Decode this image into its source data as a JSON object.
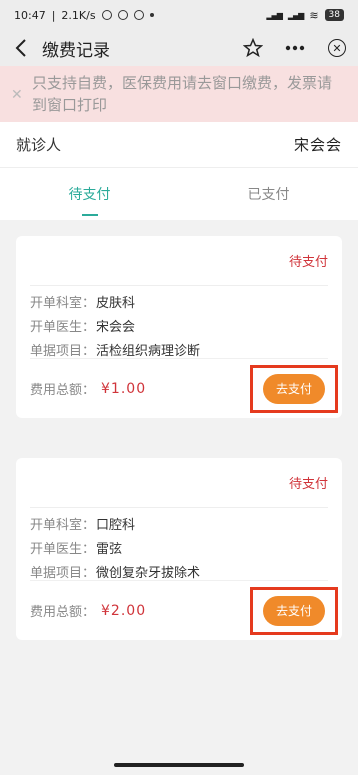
{
  "statusbar": {
    "time": "10:47",
    "speed": "2.1K/s",
    "battery": "38"
  },
  "navbar": {
    "title": "缴费记录",
    "icons": [
      "back-icon",
      "star-icon",
      "more-icon",
      "close-icon"
    ]
  },
  "notice": {
    "text": "只支持自费，医保费用请去窗口缴费，发票请到窗口打印"
  },
  "patient": {
    "label": "就诊人",
    "value": "宋会会"
  },
  "tabs": [
    {
      "label": "待支付",
      "active": true
    },
    {
      "label": "已支付",
      "active": false
    }
  ],
  "bills": [
    {
      "status": "待支付",
      "dept_key": "开单科室：",
      "dept": "皮肤科",
      "doctor_key": "开单医生：",
      "doctor": "宋会会",
      "item_key": "单据项目：",
      "item": "活检组织病理诊断",
      "total_key": "费用总额：",
      "amount": "¥1.00",
      "pay_label": "去支付"
    },
    {
      "status": "待支付",
      "dept_key": "开单科室：",
      "dept": "口腔科",
      "doctor_key": "开单医生：",
      "doctor": "雷弦",
      "item_key": "单据项目：",
      "item": "微创复杂牙拔除术",
      "total_key": "费用总额：",
      "amount": "¥2.00",
      "pay_label": "去支付"
    }
  ],
  "colors": {
    "accent": "#2bab9a",
    "status_red": "#d0343a",
    "pay_orange": "#f08a2a",
    "highlight_red": "#e53a1e"
  }
}
